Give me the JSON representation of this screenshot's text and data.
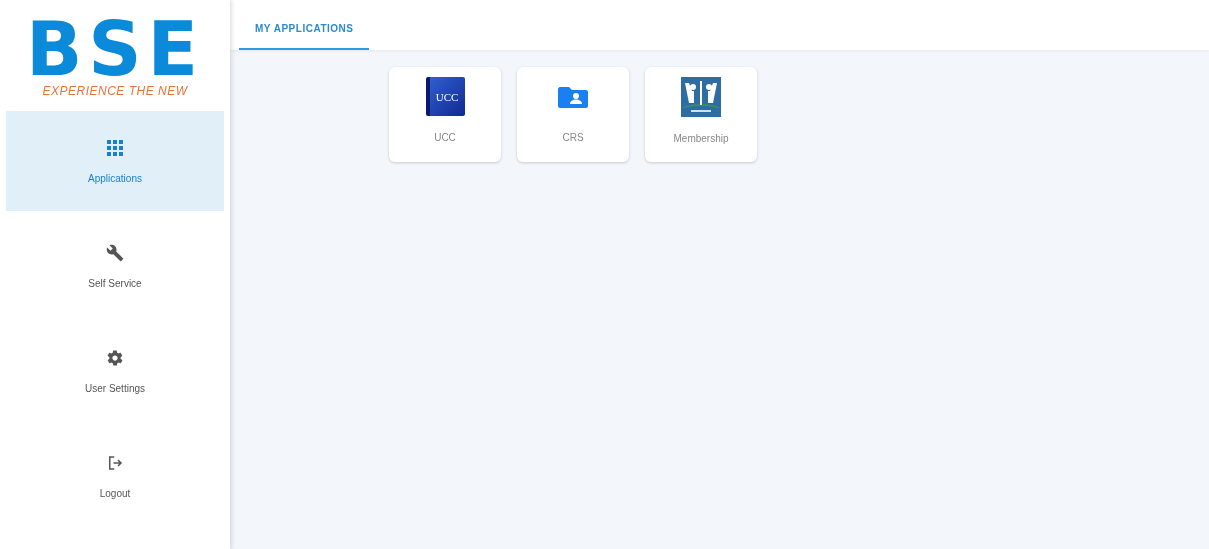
{
  "logo": {
    "mark": "BSE",
    "tagline": "EXPERIENCE THE NEW"
  },
  "sidebar": {
    "items": [
      {
        "label": "Applications",
        "kind": "grid",
        "selected": true
      },
      {
        "label": "Self Service",
        "kind": "wrench",
        "selected": false
      },
      {
        "label": "User Settings",
        "kind": "gear",
        "selected": false
      },
      {
        "label": "Logout",
        "kind": "logout",
        "selected": false
      }
    ]
  },
  "tabs": [
    {
      "label": "MY APPLICATIONS",
      "selected": true
    }
  ],
  "applications": [
    {
      "label": "UCC",
      "kind": "book",
      "icon_text": "UCC"
    },
    {
      "label": "CRS",
      "kind": "folder"
    },
    {
      "label": "Membership",
      "kind": "membership"
    }
  ]
}
